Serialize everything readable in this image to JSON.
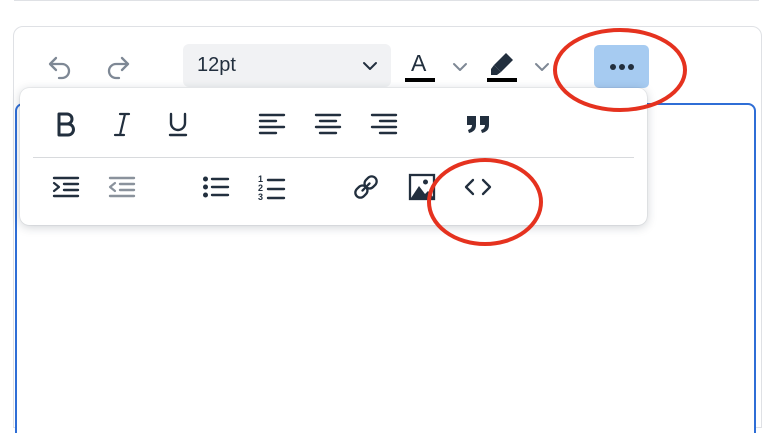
{
  "toolbar": {
    "undo_icon": "undo-icon",
    "redo_icon": "redo-icon",
    "font_size": "12pt",
    "text_color_letter": "A",
    "text_color": "#000000",
    "highlight_color": "#000000",
    "more_icon": "more-horizontal-icon",
    "more_active_bg": "#a6cbf1"
  },
  "popup_toolbar": {
    "row1": [
      "bold-icon",
      "italic-icon",
      "underline-icon",
      "align-left-icon",
      "align-center-icon",
      "align-right-icon",
      "blockquote-icon"
    ],
    "row2": [
      "indent-icon",
      "outdent-icon",
      "bullet-list-icon",
      "numbered-list-icon",
      "link-icon",
      "image-icon",
      "code-icon"
    ],
    "numbered_digits": [
      "1",
      "2",
      "3"
    ]
  },
  "annotations": {
    "color": "#e5321f",
    "targets": [
      "more-button",
      "code-button"
    ]
  },
  "editor": {
    "focus_border": "#2f6ed6"
  }
}
